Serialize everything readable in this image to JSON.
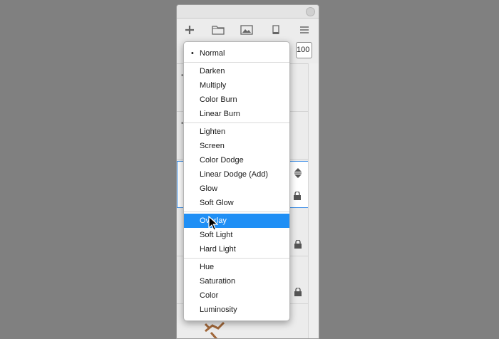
{
  "toolbar": {
    "icons": [
      "add-layer-icon",
      "folder-icon",
      "image-icon",
      "clipboard-icon",
      "menu-icon"
    ]
  },
  "opacity_value": "100",
  "blend_modes": {
    "selected": "Normal",
    "highlighted": "Overlay",
    "groups": [
      [
        "Normal"
      ],
      [
        "Darken",
        "Multiply",
        "Color Burn",
        "Linear Burn"
      ],
      [
        "Lighten",
        "Screen",
        "Color Dodge",
        "Linear Dodge (Add)",
        "Glow",
        "Soft Glow"
      ],
      [
        "Overlay",
        "Soft Light",
        "Hard Light"
      ],
      [
        "Hue",
        "Saturation",
        "Color",
        "Luminosity"
      ]
    ]
  },
  "colors": {
    "desktop": "#808080",
    "highlight": "#1f8ff5",
    "selection_border": "#3d8ee6"
  }
}
